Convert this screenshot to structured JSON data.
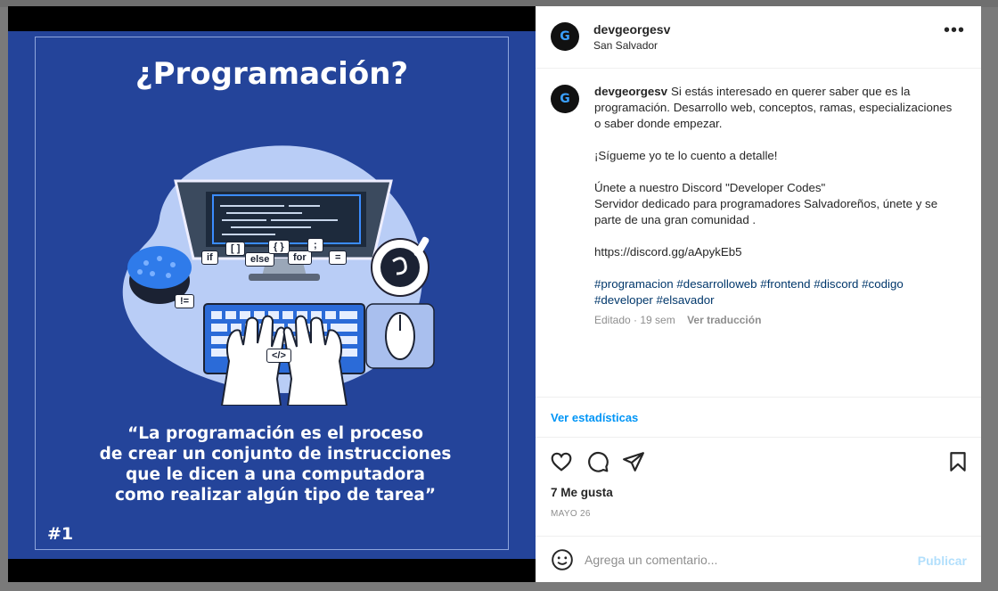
{
  "image": {
    "title": "¿Programación?",
    "code_labels": [
      "if",
      "[ ]",
      "else",
      "{ }",
      "for",
      ";",
      "=",
      "!=",
      "</>"
    ],
    "quote_lines": [
      "“La programación es el proceso",
      "de crear un conjunto de instrucciones",
      "que le dicen a una computadora",
      "como realizar algún tipo de tarea”"
    ],
    "number_tag": "#1",
    "colors": {
      "background": "#24449a",
      "accent": "#2b6bd8"
    }
  },
  "header": {
    "username": "devgeorgesv",
    "location": "San Salvador",
    "avatar_letter": "G",
    "more_icon": "more-horizontal-icon"
  },
  "caption": {
    "username": "devgeorgesv",
    "line1": "Si estás interesado en querer saber que es la programación. Desarrollo web, conceptos, ramas, especializaciones o saber donde empezar.",
    "line2": "¡Sígueme yo te lo cuento a detalle!",
    "line3": "Únete a nuestro Discord \"Developer Codes\"",
    "line4": "Servidor dedicado para programadores Salvadoreños, únete y se parte de una gran comunidad .",
    "link": "https://discord.gg/aApykEb5",
    "hashtags": [
      "#programacion",
      "#desarrolloweb",
      "#frontend",
      "#discord",
      "#codigo",
      "#developer",
      "#elsavador"
    ],
    "edited": "Editado · 19 sem",
    "translate": "Ver traducción"
  },
  "stats": {
    "label": "Ver estadísticas"
  },
  "actions": {
    "icons": [
      "heart-icon",
      "comment-icon",
      "share-icon",
      "bookmark-icon"
    ],
    "likes": "7 Me gusta",
    "date": "MAYO 26"
  },
  "comment": {
    "placeholder": "Agrega un comentario...",
    "publish": "Publicar",
    "emoji_icon": "emoji-icon"
  }
}
